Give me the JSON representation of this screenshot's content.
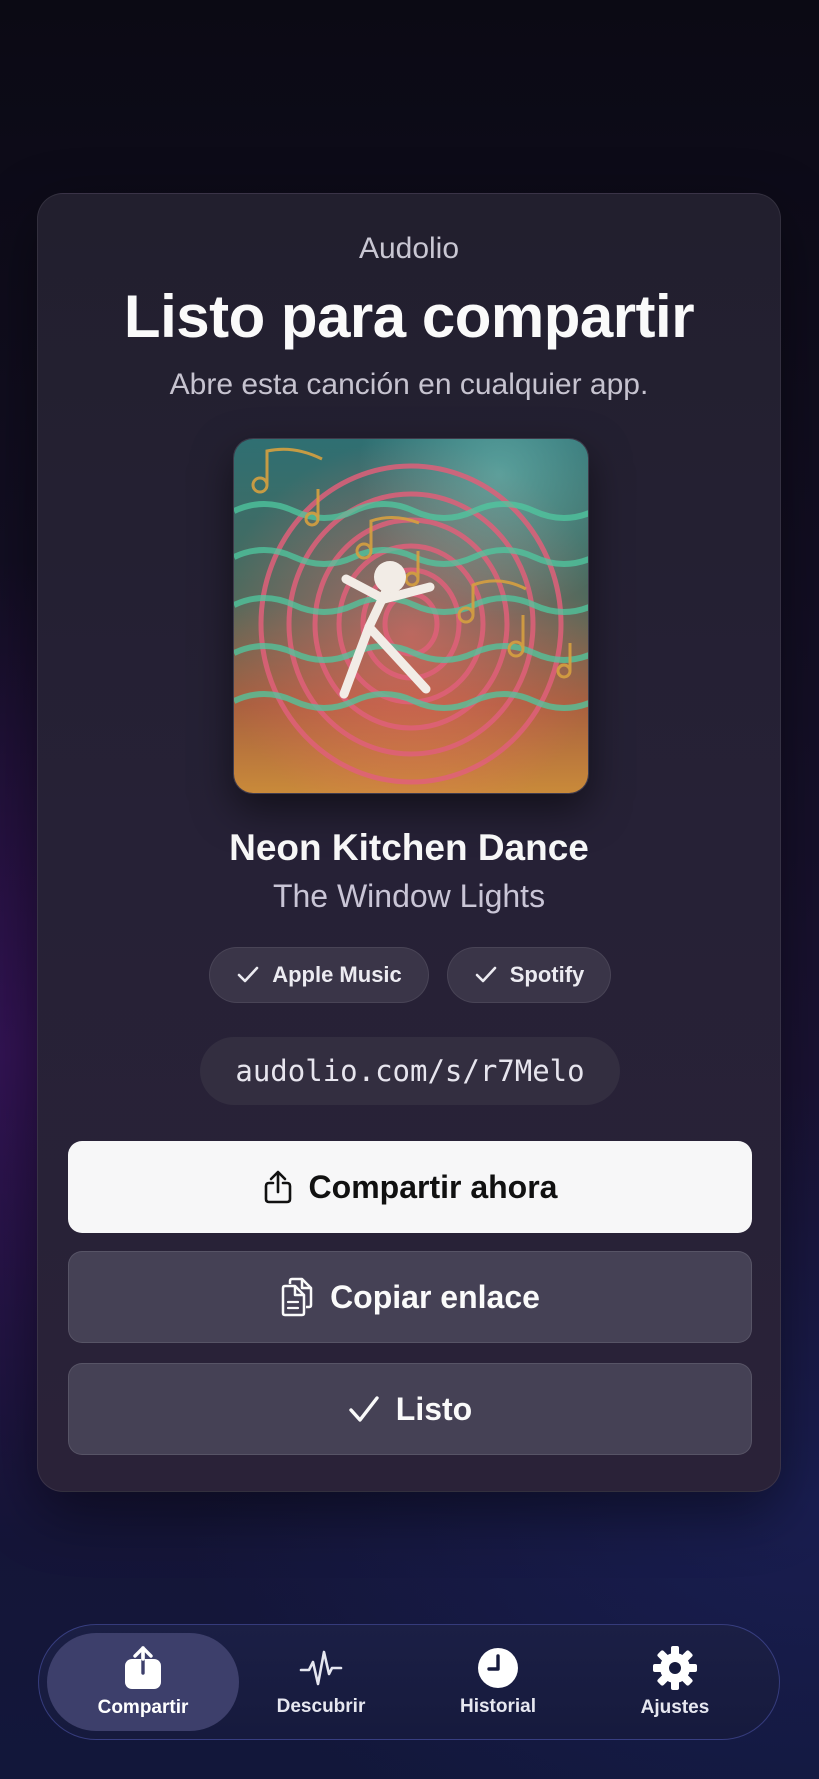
{
  "app": {
    "name": "Audolio"
  },
  "share": {
    "title": "Listo para compartir",
    "subtitle": "Abre esta canción en cualquier app.",
    "song_title": "Neon Kitchen Dance",
    "artist": "The Window Lights",
    "services": [
      {
        "label": "Apple Music",
        "icon": "check-icon"
      },
      {
        "label": "Spotify",
        "icon": "check-icon"
      }
    ],
    "link": "audolio.com/s/r7Melo"
  },
  "actions": {
    "share_now": "Compartir ahora",
    "copy_link": "Copiar enlace",
    "done": "Listo"
  },
  "tabbar": {
    "items": [
      {
        "label": "Compartir",
        "icon": "share-icon",
        "active": true
      },
      {
        "label": "Descubrir",
        "icon": "pulse-icon",
        "active": false
      },
      {
        "label": "Historial",
        "icon": "clock-icon",
        "active": false
      },
      {
        "label": "Ajustes",
        "icon": "gear-icon",
        "active": false
      }
    ]
  },
  "colors": {
    "primary_button": "#f7f7f8",
    "secondary_button": "#454155",
    "tab_active": "#3d3f6b"
  }
}
